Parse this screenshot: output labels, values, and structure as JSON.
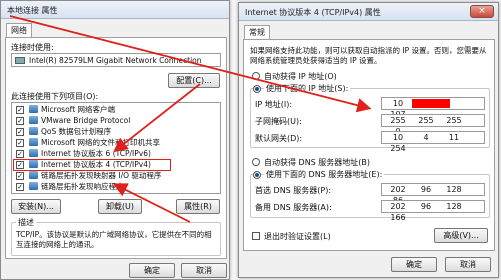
{
  "left_window": {
    "title": "本地连接 属性",
    "tab": "网络",
    "connect_label": "连接时使用:",
    "adapter": "Intel(R) 82579LM Gigabit Network Connection",
    "configure_button": "配置(C)...",
    "items_label": "此连接使用下列项目(O):",
    "items": [
      {
        "label": "Microsoft 网络客户端",
        "checked": true
      },
      {
        "label": "VMware Bridge Protocol",
        "checked": true
      },
      {
        "label": "QoS 数据包计划程序",
        "checked": true
      },
      {
        "label": "Microsoft 网络的文件和打印机共享",
        "checked": true
      },
      {
        "label": "Internet 协议版本 6 (TCP/IPv6)",
        "checked": true
      },
      {
        "label": "Internet 协议版本 4 (TCP/IPv4)",
        "checked": true
      },
      {
        "label": "链路层拓扑发现映射器 I/O 驱动程序",
        "checked": true
      },
      {
        "label": "链路层拓扑发现响应程序",
        "checked": true
      }
    ],
    "install_button": "安装(N)...",
    "uninstall_button": "卸载(U)",
    "properties_button": "属性(R)",
    "description_label": "描述",
    "description_text": "TCP/IP。该协议是默认的广域网络协议，它提供在不同的相互连接的网络上的通讯。",
    "ok_button": "确定",
    "cancel_button": "取消"
  },
  "right_window": {
    "title": "Internet 协议版本 4 (TCP/IPv4) 属性",
    "close_glyph": "×",
    "tab": "常规",
    "intro": "如果网络支持此功能，则可以获取自动指派的 IP 设置。否则，您需要从网络系统管理员处获得适当的 IP 设置。",
    "auto_ip": "自动获得 IP 地址(O)",
    "manual_ip": "使用下面的 IP 地址(S):",
    "ip_label": "IP 地址(I):",
    "ip_value": [
      "10",
      "",
      "",
      "107"
    ],
    "subnet_label": "子网掩码(U):",
    "subnet_value": [
      "255",
      "255",
      "255",
      "0"
    ],
    "gateway_label": "默认网关(D):",
    "gateway_value": [
      "10",
      "4",
      "11",
      "254"
    ],
    "auto_dns": "自动获得 DNS 服务器地址(B)",
    "manual_dns": "使用下面的 DNS 服务器地址(E):",
    "dns1_label": "首选 DNS 服务器(P):",
    "dns1_value": [
      "202",
      "96",
      "128",
      "86"
    ],
    "dns2_label": "备用 DNS 服务器(A):",
    "dns2_value": [
      "202",
      "96",
      "128",
      "166"
    ],
    "validate_label": "退出时验证设置(L)",
    "advanced_button": "高级(V)...",
    "ok_button": "确定",
    "cancel_button": "取消"
  },
  "colors": {
    "annotation_red": "#e0201a",
    "redaction_red": "#ff0000"
  }
}
